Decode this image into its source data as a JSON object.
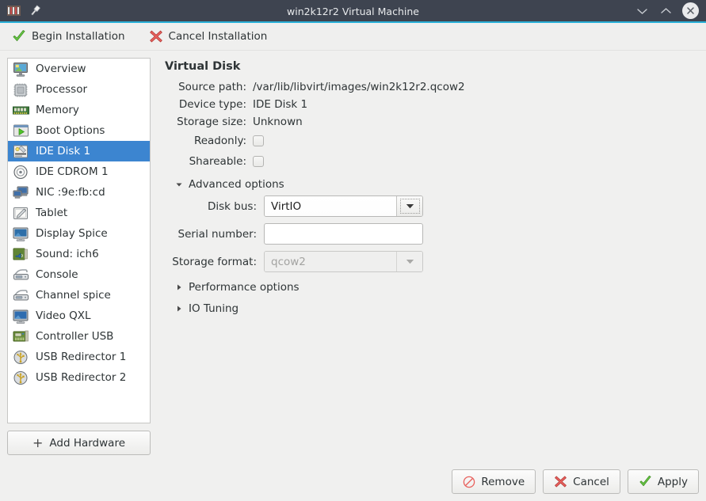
{
  "window": {
    "title": "win2k12r2 Virtual Machine",
    "app_icon": "virt-manager-icon",
    "pin_icon": "pin-icon",
    "minimize_icon": "chevron-down-icon",
    "maximize_icon": "chevron-up-icon",
    "close_icon": "close-icon",
    "accent_color": "#2ab0d8",
    "titlebar_color": "#3e4450"
  },
  "toolbar": {
    "begin_label": "Begin Installation",
    "begin_icon": "green-check-icon",
    "cancel_label": "Cancel Installation",
    "cancel_icon": "red-x-icon"
  },
  "sidebar": {
    "selected_index": 4,
    "selected_color": "#3c85d0",
    "items": [
      {
        "label": "Overview",
        "icon": "computer-overview-icon"
      },
      {
        "label": "Processor",
        "icon": "cpu-chip-icon"
      },
      {
        "label": "Memory",
        "icon": "memory-ram-icon"
      },
      {
        "label": "Boot Options",
        "icon": "boot-play-icon"
      },
      {
        "label": "IDE Disk 1",
        "icon": "hard-disk-icon"
      },
      {
        "label": "IDE CDROM 1",
        "icon": "cdrom-disc-icon"
      },
      {
        "label": "NIC :9e:fb:cd",
        "icon": "network-card-icon"
      },
      {
        "label": "Tablet",
        "icon": "tablet-pen-icon"
      },
      {
        "label": "Display Spice",
        "icon": "display-monitor-icon"
      },
      {
        "label": "Sound: ich6",
        "icon": "sound-card-icon"
      },
      {
        "label": "Console",
        "icon": "console-serial-icon"
      },
      {
        "label": "Channel spice",
        "icon": "channel-serial-icon"
      },
      {
        "label": "Video QXL",
        "icon": "video-monitor-icon"
      },
      {
        "label": "Controller USB",
        "icon": "usb-controller-card-icon"
      },
      {
        "label": "USB Redirector 1",
        "icon": "usb-redirector-icon"
      },
      {
        "label": "USB Redirector 2",
        "icon": "usb-redirector-icon"
      }
    ],
    "add_hardware_label": "Add Hardware",
    "add_hardware_icon": "plus-icon"
  },
  "main": {
    "title": "Virtual Disk",
    "fields": [
      {
        "label": "Source path:",
        "value": "/var/lib/libvirt/images/win2k12r2.qcow2"
      },
      {
        "label": "Device type:",
        "value": "IDE Disk 1"
      },
      {
        "label": "Storage size:",
        "value": "Unknown"
      }
    ],
    "checkboxes": [
      {
        "label": "Readonly:",
        "checked": false
      },
      {
        "label": "Shareable:",
        "checked": false
      }
    ],
    "advanced": {
      "label": "Advanced options",
      "expanded": true,
      "expander_icon": "triangle-down-icon",
      "disk_bus": {
        "label": "Disk bus:",
        "value": "VirtIO",
        "dropdown_icon": "chevron-down-icon",
        "focused": true
      },
      "serial_number": {
        "label": "Serial number:",
        "value": "",
        "placeholder": ""
      },
      "storage_format": {
        "label": "Storage format:",
        "value": "qcow2",
        "dropdown_icon": "chevron-down-icon",
        "disabled": true
      }
    },
    "performance_options": {
      "label": "Performance options",
      "expanded": false,
      "expander_icon": "triangle-right-icon"
    },
    "io_tuning": {
      "label": "IO Tuning",
      "expanded": false,
      "expander_icon": "triangle-right-icon"
    }
  },
  "footer": {
    "remove_label": "Remove",
    "remove_icon": "no-entry-icon",
    "cancel_label": "Cancel",
    "cancel_icon": "red-x-icon",
    "apply_label": "Apply",
    "apply_icon": "green-check-icon"
  }
}
